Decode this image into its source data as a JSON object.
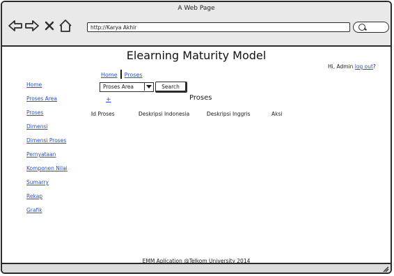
{
  "window": {
    "title": "A Web Page"
  },
  "browser": {
    "url": "http://Karya Akhir",
    "icons": [
      "back-arrow-icon",
      "forward-arrow-icon",
      "close-x-icon",
      "home-icon",
      "search-icon"
    ]
  },
  "header": {
    "page_title": "Elearning Maturity Model",
    "greeting_prefix": "Hi, Admin",
    "logout_label": "log out",
    "greeting_suffix": "?"
  },
  "breadcrumb": {
    "items": [
      "Home",
      "Proses"
    ]
  },
  "filter": {
    "selected": "Proses Area",
    "search_label": "Search"
  },
  "section": {
    "add_label": "+",
    "title": "Proses"
  },
  "table": {
    "columns": [
      "Id Proses",
      "Deskripsi Indonesia",
      "Deskripsi Inggris",
      "Aksi"
    ],
    "rows": []
  },
  "sidebar": {
    "items": [
      "Home",
      "Proses Area",
      "Proses",
      "Dimensi",
      "Dimensi Proses",
      "Pernyataan",
      "Komponen Nilai",
      "Sumarry",
      "Rekap",
      "Grafik"
    ]
  },
  "footer": {
    "text": "EMM Aplication @Telkom University 2014"
  },
  "colors": {
    "link": "#2a52be",
    "chrome": "#e9e9e9",
    "border": "#2b2b2b"
  }
}
